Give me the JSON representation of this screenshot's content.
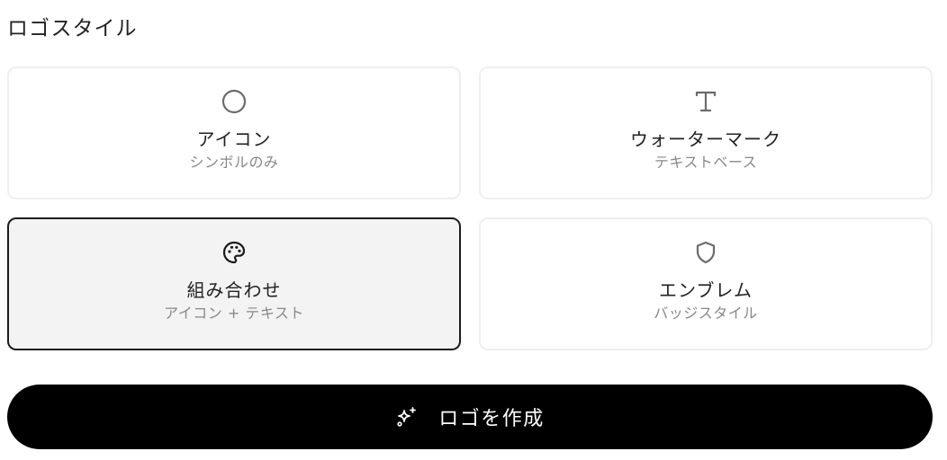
{
  "section": {
    "title": "ロゴスタイル"
  },
  "styles": [
    {
      "id": "icon",
      "icon": "circle-icon",
      "label": "アイコン",
      "description": "シンボルのみ",
      "selected": false
    },
    {
      "id": "wordmark",
      "icon": "type-icon",
      "label": "ウォーターマーク",
      "description": "テキストベース",
      "selected": false
    },
    {
      "id": "combination",
      "icon": "palette-icon",
      "label": "組み合わせ",
      "description": "アイコン + テキスト",
      "selected": true
    },
    {
      "id": "emblem",
      "icon": "shield-icon",
      "label": "エンブレム",
      "description": "バッジスタイル",
      "selected": false
    }
  ],
  "create_button": {
    "icon": "sparkles-icon",
    "label": "ロゴを作成"
  },
  "colors": {
    "primary": "#000000",
    "selected_border": "#1c1c1c",
    "selected_bg": "#f3f3f3",
    "card_border": "#efefef",
    "muted_text": "#888888",
    "icon_stroke": "#6b6b6b"
  }
}
